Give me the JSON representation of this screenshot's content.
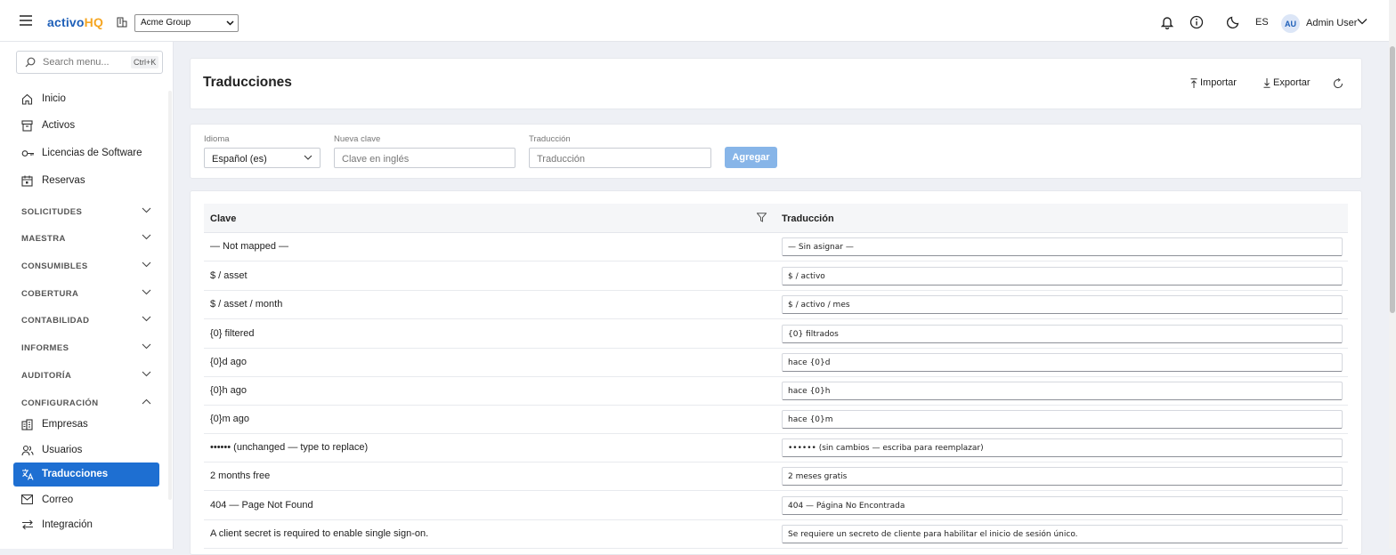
{
  "topbar": {
    "logo_main": "activo",
    "logo_accent": "HQ",
    "org_select": "Acme Group",
    "lang": "ES",
    "avatar": "AU",
    "username": "Admin User"
  },
  "sidebar": {
    "search_placeholder": "Search menu...",
    "search_shortcut": "Ctrl+K",
    "items": [
      {
        "label": "Inicio",
        "icon": "home-icon"
      },
      {
        "label": "Activos",
        "icon": "archive-icon"
      },
      {
        "label": "Licencias de Software",
        "icon": "key-icon"
      },
      {
        "label": "Reservas",
        "icon": "calendar-icon"
      }
    ],
    "sections": [
      {
        "label": "SOLICITUDES",
        "expanded": false
      },
      {
        "label": "MAESTRA",
        "expanded": false
      },
      {
        "label": "CONSUMIBLES",
        "expanded": false
      },
      {
        "label": "COBERTURA",
        "expanded": false
      },
      {
        "label": "CONTABILIDAD",
        "expanded": false
      },
      {
        "label": "INFORMES",
        "expanded": false
      },
      {
        "label": "AUDITORÍA",
        "expanded": false
      },
      {
        "label": "CONFIGURACIÓN",
        "expanded": true
      }
    ],
    "config_items": [
      {
        "label": "Empresas",
        "icon": "building-icon"
      },
      {
        "label": "Usuarios",
        "icon": "users-icon"
      },
      {
        "label": "Traducciones",
        "icon": "translate-icon",
        "active": true
      },
      {
        "label": "Correo",
        "icon": "mail-icon"
      },
      {
        "label": "Integración",
        "icon": "arrows-icon"
      }
    ]
  },
  "page": {
    "title": "Traducciones",
    "import_label": "Importar",
    "export_label": "Exportar"
  },
  "form": {
    "language_label": "Idioma",
    "language_value": "Español (es)",
    "key_label": "Nueva clave",
    "key_placeholder": "Clave en inglés",
    "translation_label": "Traducción",
    "translation_placeholder": "Traducción",
    "add_label": "Agregar"
  },
  "table": {
    "col_key": "Clave",
    "col_translation": "Traducción",
    "rows": [
      {
        "key": "— Not mapped —",
        "value": "— Sin asignar —"
      },
      {
        "key": "$ / asset",
        "value": "$ / activo"
      },
      {
        "key": "$ / asset / month",
        "value": "$ / activo / mes"
      },
      {
        "key": "{0} filtered",
        "value": "{0} filtrados"
      },
      {
        "key": "{0}d ago",
        "value": "hace {0}d"
      },
      {
        "key": "{0}h ago",
        "value": "hace {0}h"
      },
      {
        "key": "{0}m ago",
        "value": "hace {0}m"
      },
      {
        "key": "•••••• (unchanged — type to replace)",
        "value": "•••••• (sin cambios — escriba para reemplazar)"
      },
      {
        "key": "2 months free",
        "value": "2 meses gratis"
      },
      {
        "key": "404 — Page Not Found",
        "value": "404 — Página No Encontrada"
      },
      {
        "key": "A client secret is required to enable single sign-on.",
        "value": "Se requiere un secreto de cliente para habilitar el inicio de sesión único."
      }
    ]
  },
  "colors": {
    "brand": "#1e5fb8",
    "accent": "#f5a623",
    "active_nav": "#1e6fd2",
    "add_button": "#87b5e8"
  }
}
